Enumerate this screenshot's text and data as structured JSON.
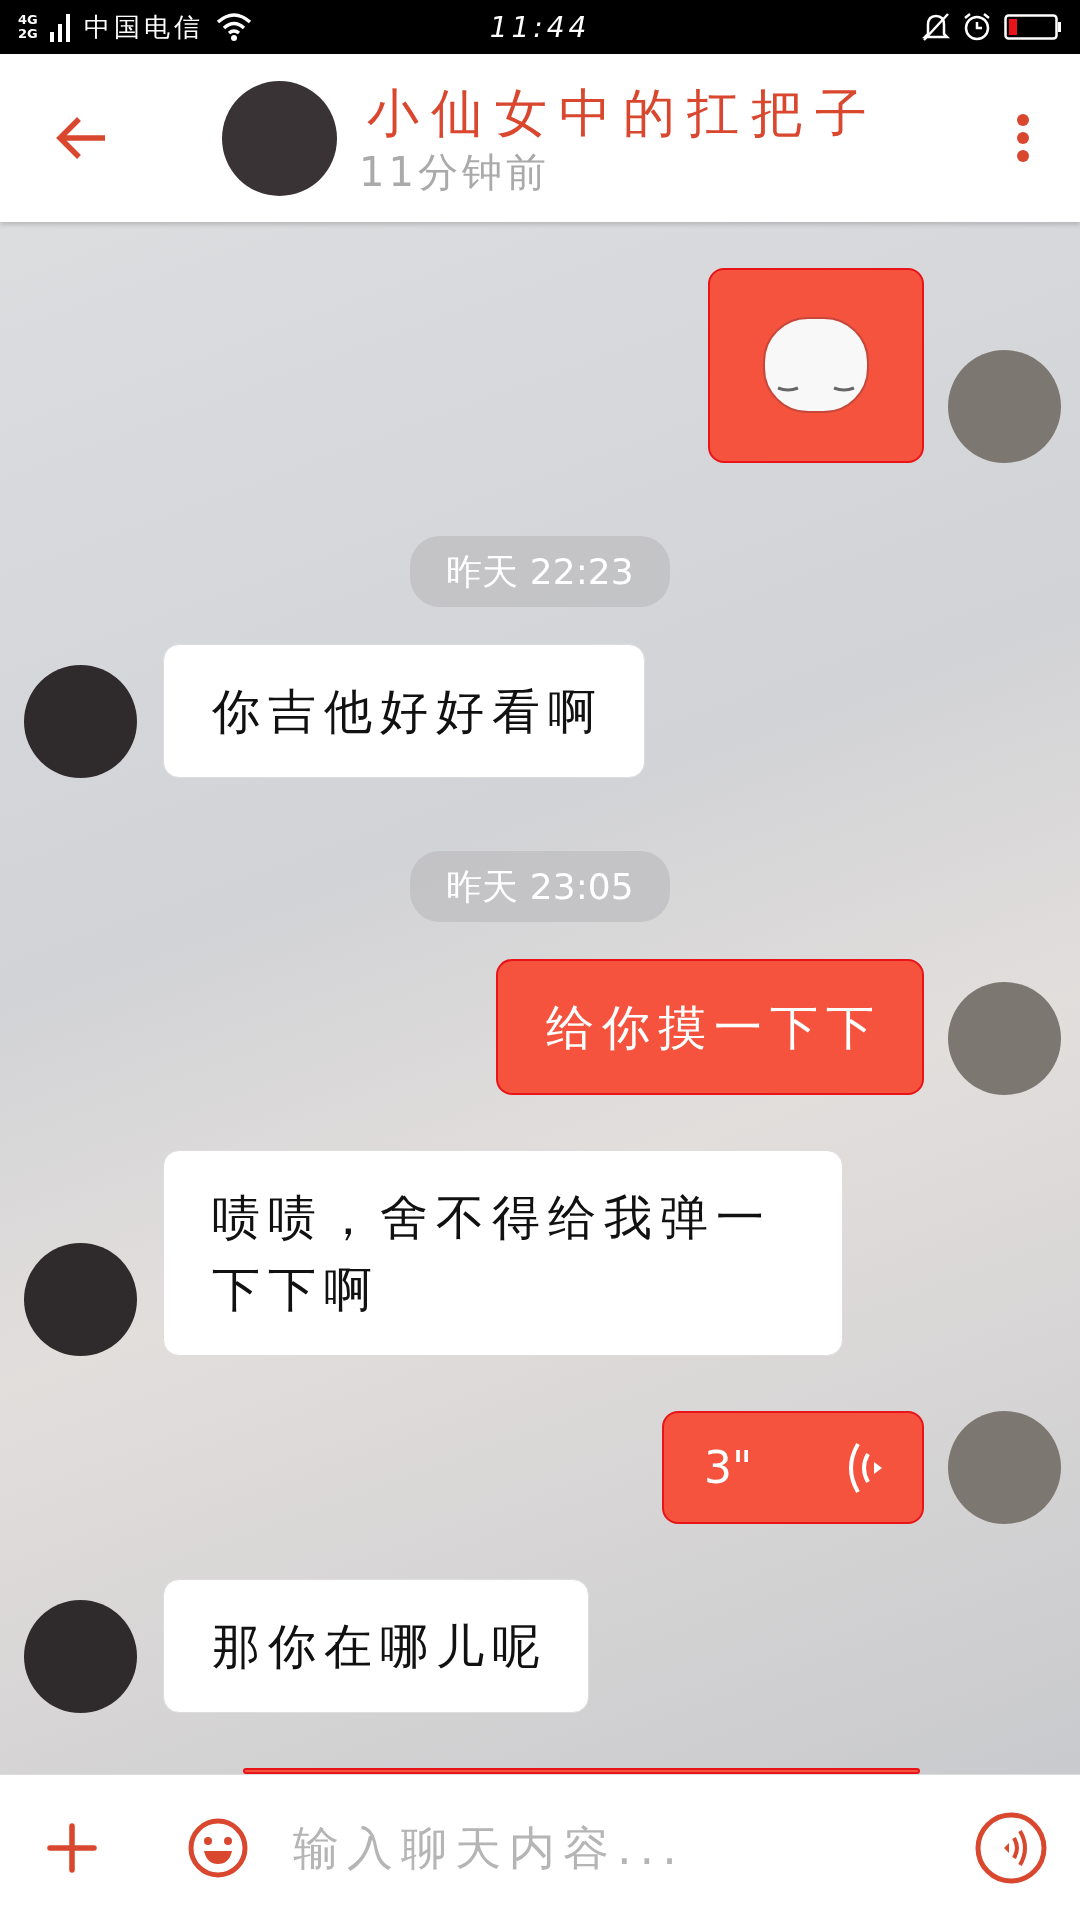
{
  "status_bar": {
    "network": "4G",
    "network_2": "2G",
    "carrier": "中国电信",
    "time": "11:44"
  },
  "header": {
    "title": "小仙女中的扛把子",
    "subtitle": "11分钟前"
  },
  "messages": [
    {
      "kind": "sticker",
      "outgoing": true
    },
    {
      "kind": "time",
      "text": "昨天 22:23"
    },
    {
      "kind": "text",
      "outgoing": false,
      "text": "你吉他好好看啊"
    },
    {
      "kind": "time",
      "text": "昨天 23:05"
    },
    {
      "kind": "text",
      "outgoing": true,
      "text": "给你摸一下下"
    },
    {
      "kind": "text",
      "outgoing": false,
      "text": "啧啧，舍不得给我弹一下下啊"
    },
    {
      "kind": "voice",
      "outgoing": true,
      "text": "3\""
    },
    {
      "kind": "text",
      "outgoing": false,
      "text": "那你在哪儿呢"
    }
  ],
  "input": {
    "placeholder": "输入聊天内容..."
  }
}
